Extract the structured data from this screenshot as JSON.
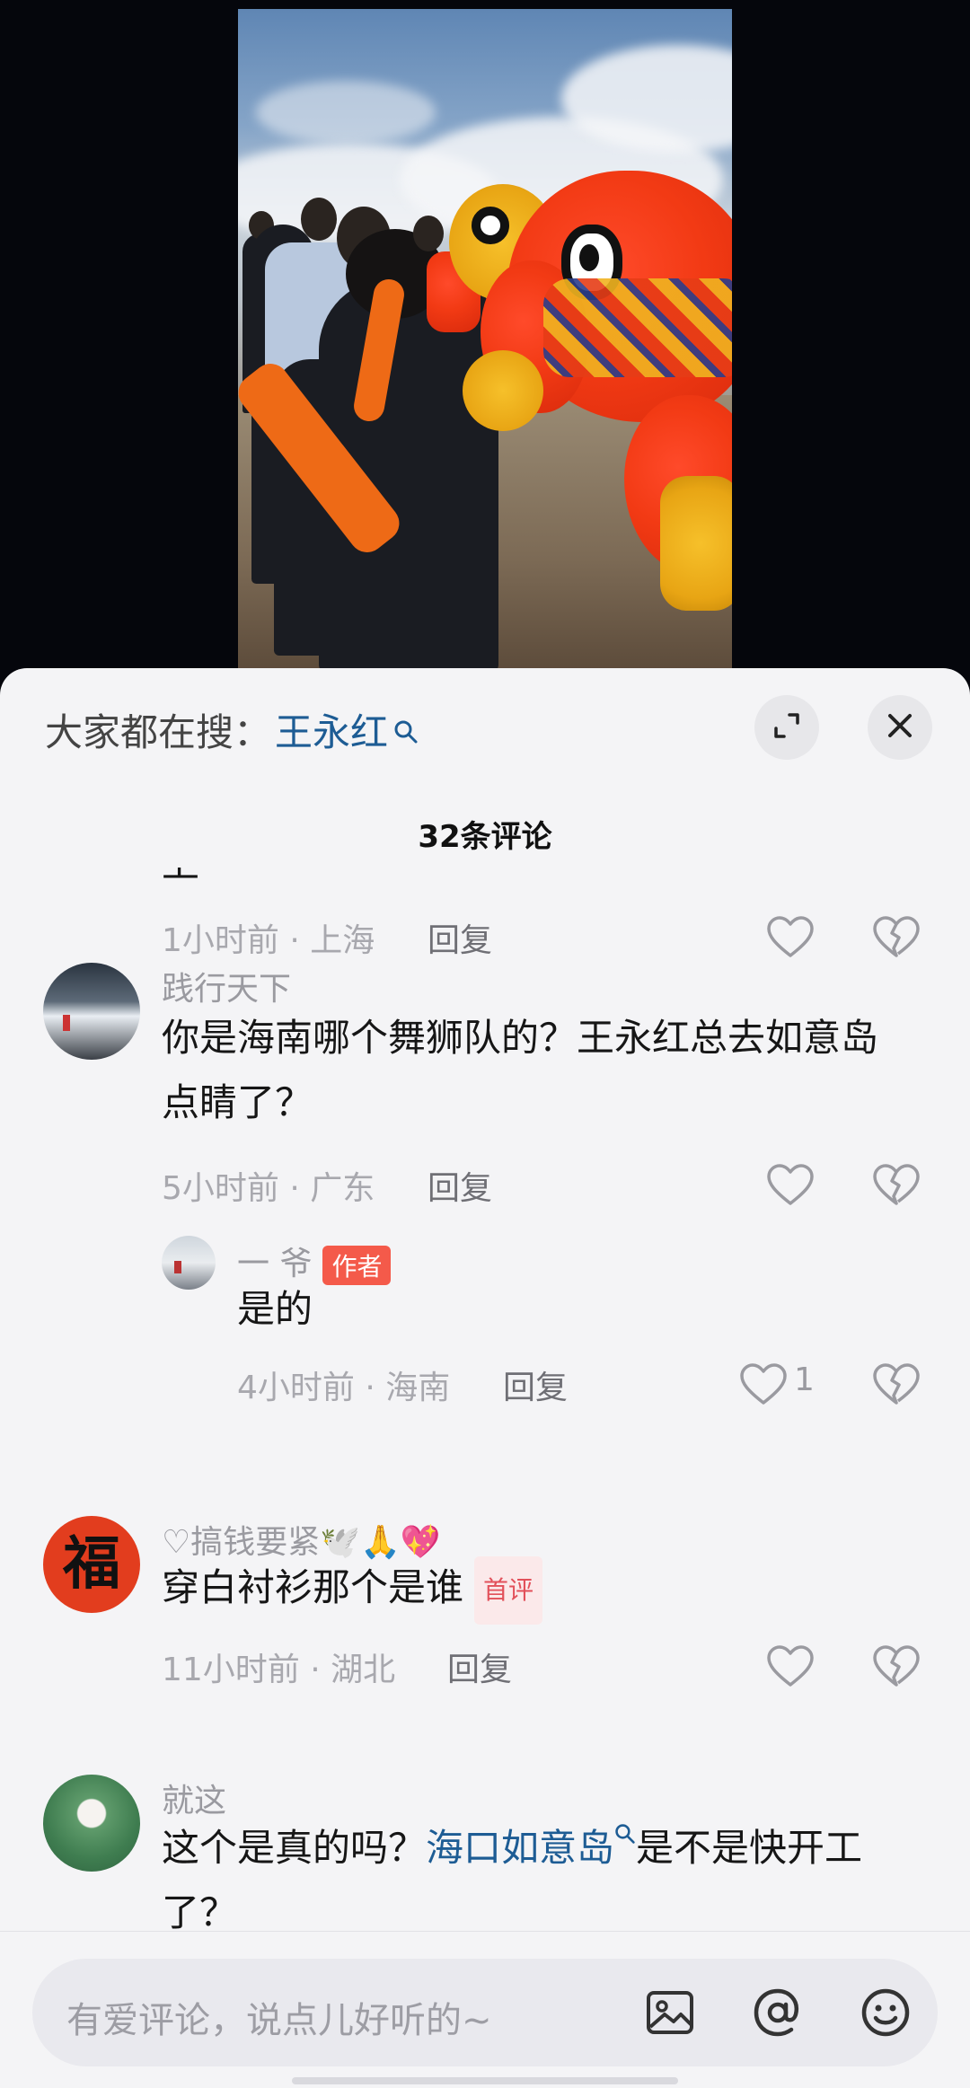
{
  "search": {
    "label": "大家都在搜：",
    "keyword": "王永红"
  },
  "comment_count_title": "32条评论",
  "comments": [
    {
      "partial_text": "上",
      "time_loc": "1小时前 · 上海",
      "reply": "回复"
    },
    {
      "user": "践行天下",
      "text": "你是海南哪个舞狮队的？王永红总去如意岛点睛了？",
      "time_loc": "5小时前 · 广东",
      "reply": "回复"
    },
    {
      "user": "一 爷",
      "author_tag": "作者",
      "text": "是的",
      "time_loc": "4小时前 · 海南",
      "reply": "回复",
      "likes": "1"
    },
    {
      "user": "♡搞钱要紧🕊️🙏💖",
      "avatar_char": "福",
      "text": "穿白衬衫那个是谁",
      "first_tag": "首评",
      "time_loc": "11小时前 · 湖北",
      "reply": "回复"
    },
    {
      "user": "就这",
      "text_pre": "这个是真的吗？",
      "text_link": "海口如意岛",
      "text_post": "是不是快开工了？"
    }
  ],
  "input": {
    "placeholder": "有爱评论，说点儿好听的~"
  },
  "icons": [
    "search-icon",
    "expand-icon",
    "close-icon",
    "heart-icon",
    "broken-heart-icon",
    "image-icon",
    "at-icon",
    "emoji-icon"
  ]
}
